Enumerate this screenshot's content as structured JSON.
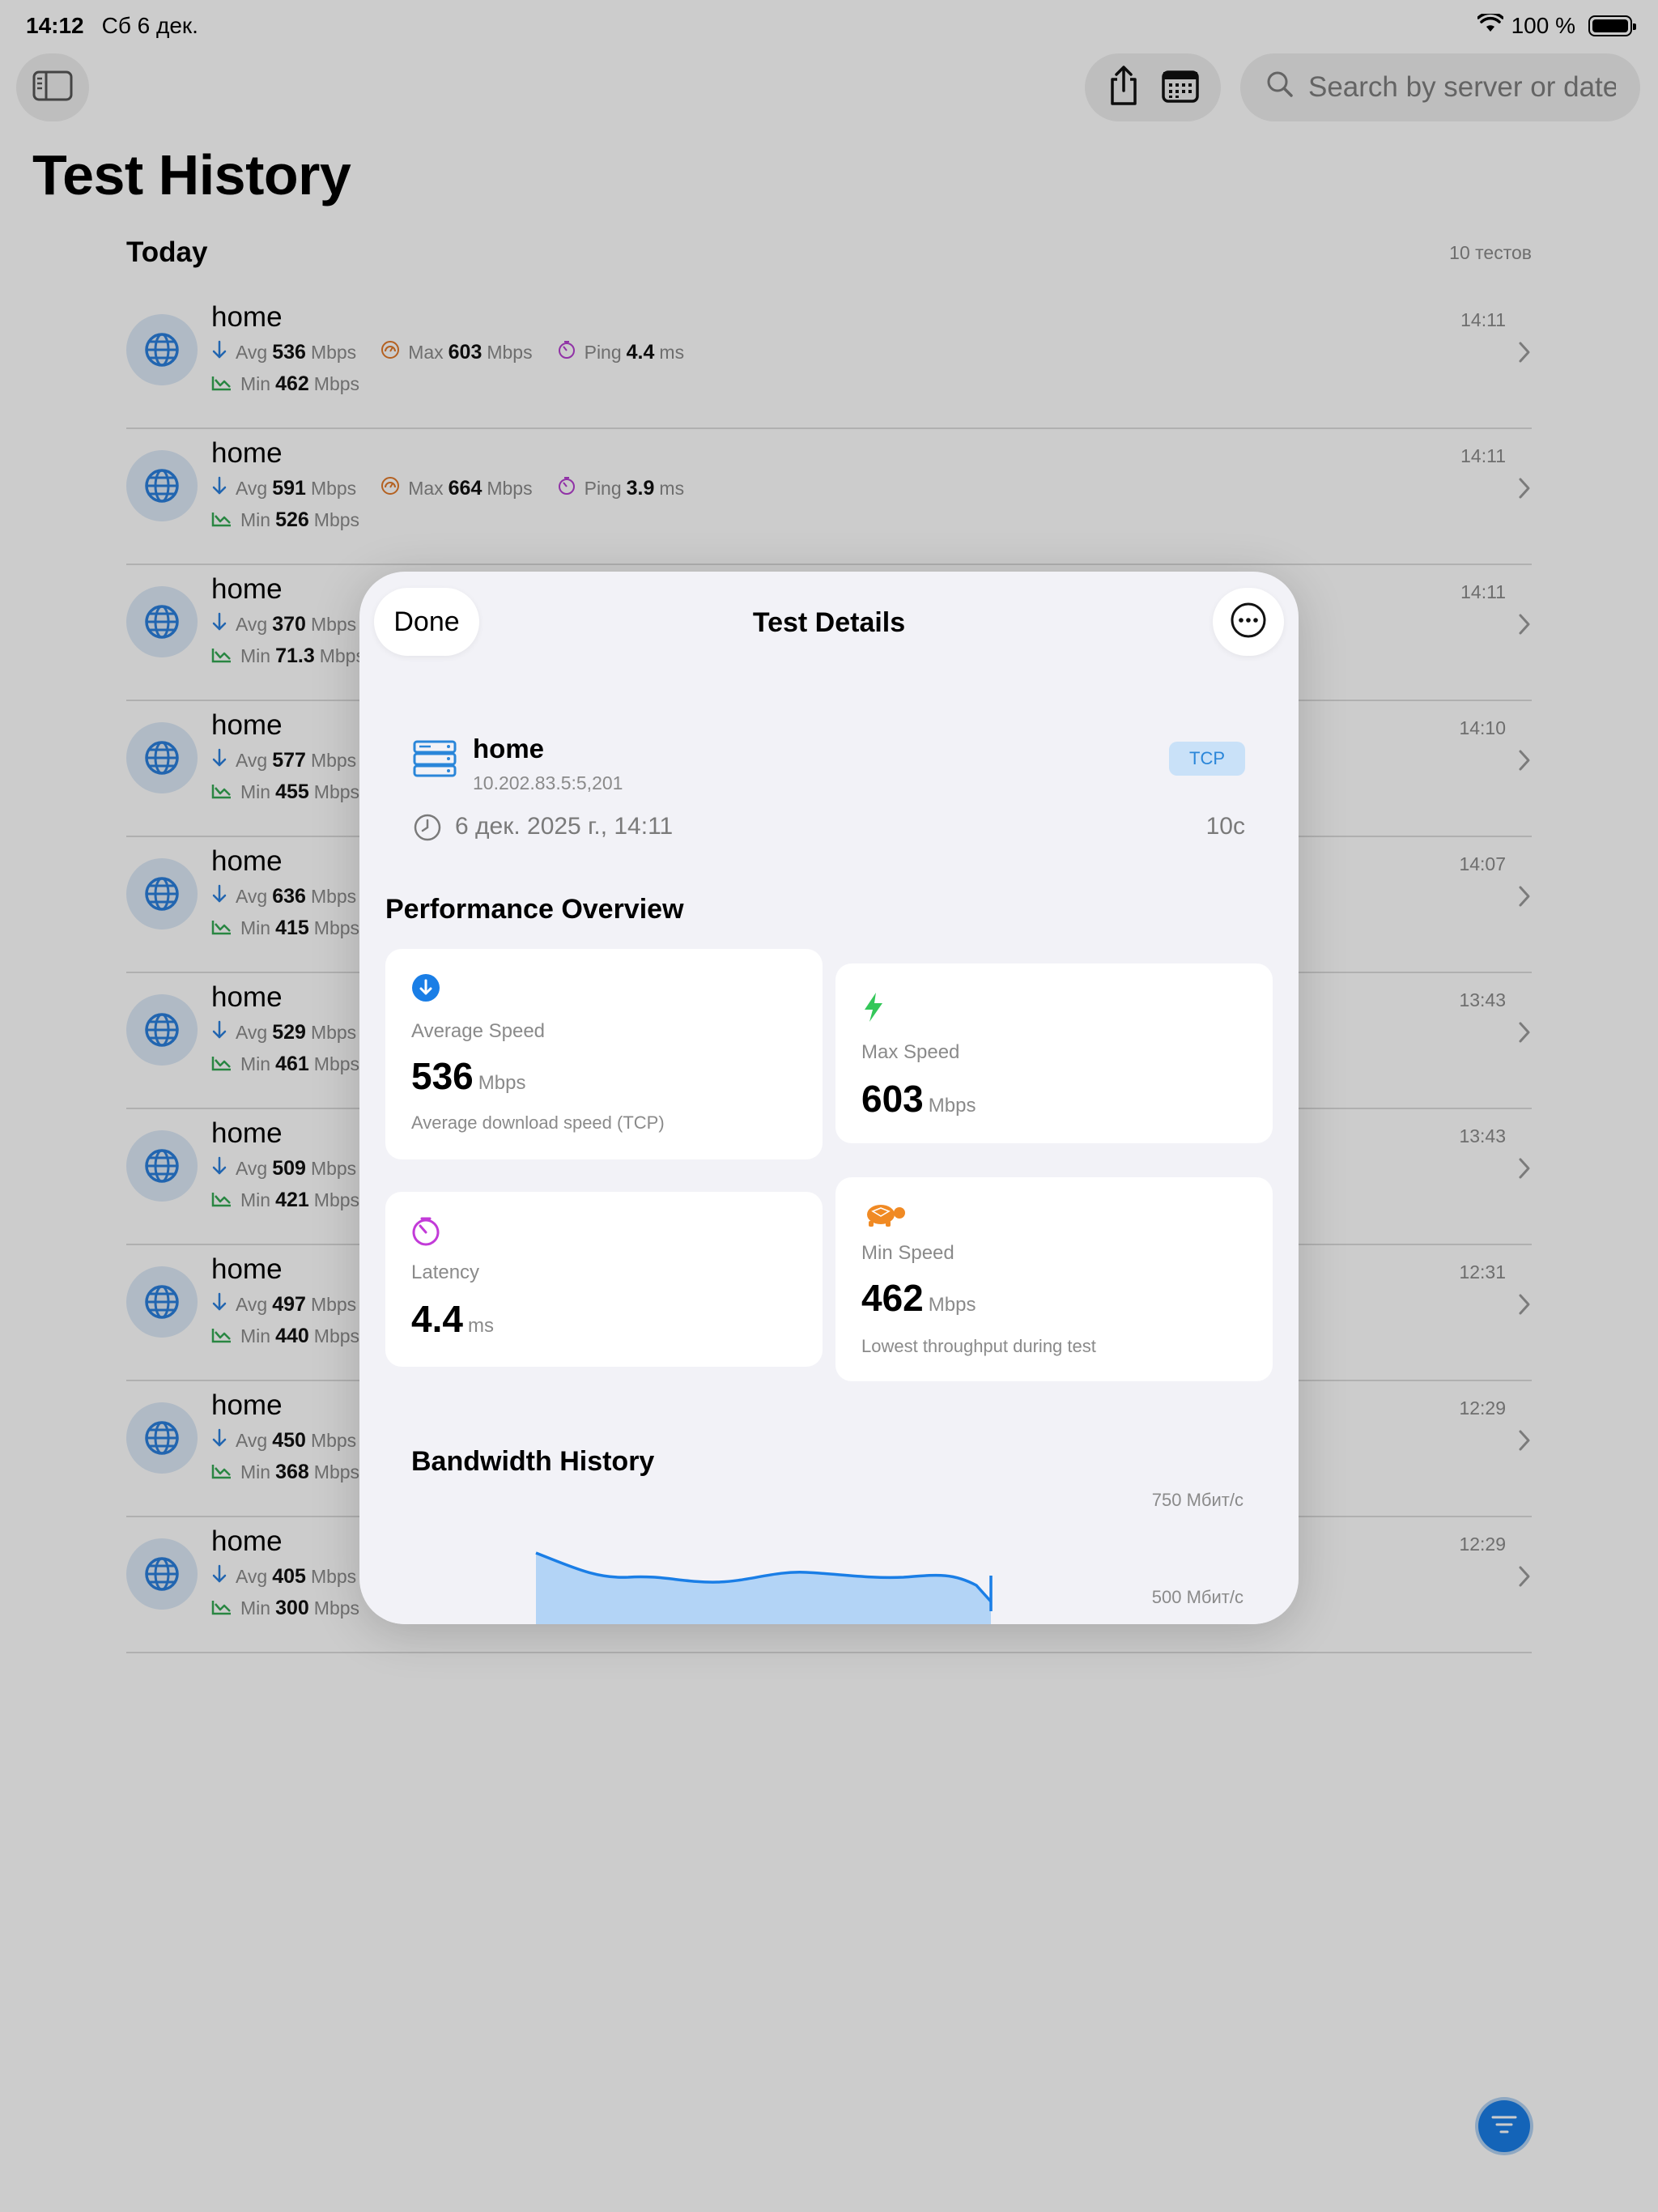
{
  "status_bar": {
    "time": "14:12",
    "date": "Сб 6 дек.",
    "battery": "100 %"
  },
  "toolbar": {
    "search_placeholder": "Search by server or date"
  },
  "page_title": "Test History",
  "section": {
    "title": "Today",
    "count": "10 тестов"
  },
  "labels": {
    "avg": "Avg",
    "max": "Max",
    "min": "Min",
    "ping": "Ping",
    "unit": "Mbps",
    "ms": "ms"
  },
  "rows": [
    {
      "name": "home",
      "avg": "536",
      "max": "603",
      "ping": "4.4",
      "min": "462",
      "time": "14:11"
    },
    {
      "name": "home",
      "avg": "591",
      "max": "664",
      "ping": "3.9",
      "min": "526",
      "time": "14:11"
    },
    {
      "name": "home",
      "avg": "370",
      "min": "71.3",
      "time": "14:11"
    },
    {
      "name": "home",
      "avg": "577",
      "min": "455",
      "time": "14:10"
    },
    {
      "name": "home",
      "avg": "636",
      "min": "415",
      "time": "14:07"
    },
    {
      "name": "home",
      "avg": "529",
      "min": "461",
      "time": "13:43"
    },
    {
      "name": "home",
      "avg": "509",
      "min": "421",
      "time": "13:43"
    },
    {
      "name": "home",
      "avg": "497",
      "min": "440",
      "time": "12:31"
    },
    {
      "name": "home",
      "avg": "450",
      "min": "368",
      "time": "12:29"
    },
    {
      "name": "home",
      "avg": "405",
      "min": "300",
      "time": "12:29"
    }
  ],
  "modal": {
    "done_label": "Done",
    "title": "Test Details",
    "server": {
      "name": "home",
      "address": "10.202.83.5:5,201",
      "protocol": "TCP",
      "datetime": "6 дек. 2025 г., 14:11",
      "duration": "10с"
    },
    "perf_title": "Performance Overview",
    "average": {
      "label": "Average Speed",
      "value": "536",
      "unit": "Mbps",
      "note": "Average download speed (TCP)"
    },
    "max": {
      "label": "Max Speed",
      "value": "603",
      "unit": "Mbps"
    },
    "latency": {
      "label": "Latency",
      "value": "4.4",
      "unit": "ms"
    },
    "min": {
      "label": "Min Speed",
      "value": "462",
      "unit": "Mbps",
      "note": "Lowest throughput during test"
    },
    "bandwidth": {
      "title": "Bandwidth History",
      "tick_top": "750 Мбит/с",
      "tick_mid": "500 Мбит/с"
    }
  },
  "colors": {
    "accent": "#1a7ee6",
    "download": "#2a7fdc",
    "max": "#e27a2a",
    "ping": "#b53fd0",
    "min": "#34a853",
    "turtle": "#f08a24"
  }
}
